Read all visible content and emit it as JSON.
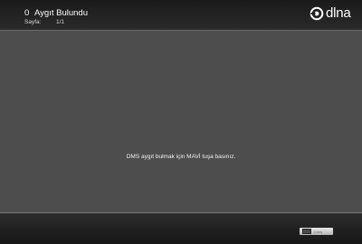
{
  "header": {
    "count": "0",
    "title": "Aygıt Bulundu",
    "page_label": "Sayfa:",
    "page_value": "1/1",
    "brand": "dlna"
  },
  "main": {
    "message": "DMS aygıt bulmak için MAVİ tuşa basınız."
  },
  "footer": {
    "key_label": "Çıkış"
  },
  "colors": {
    "background": "#4d4d4d",
    "header": "#1f1f1f",
    "footer": "#1f1f1f",
    "text": "#ffffff"
  }
}
